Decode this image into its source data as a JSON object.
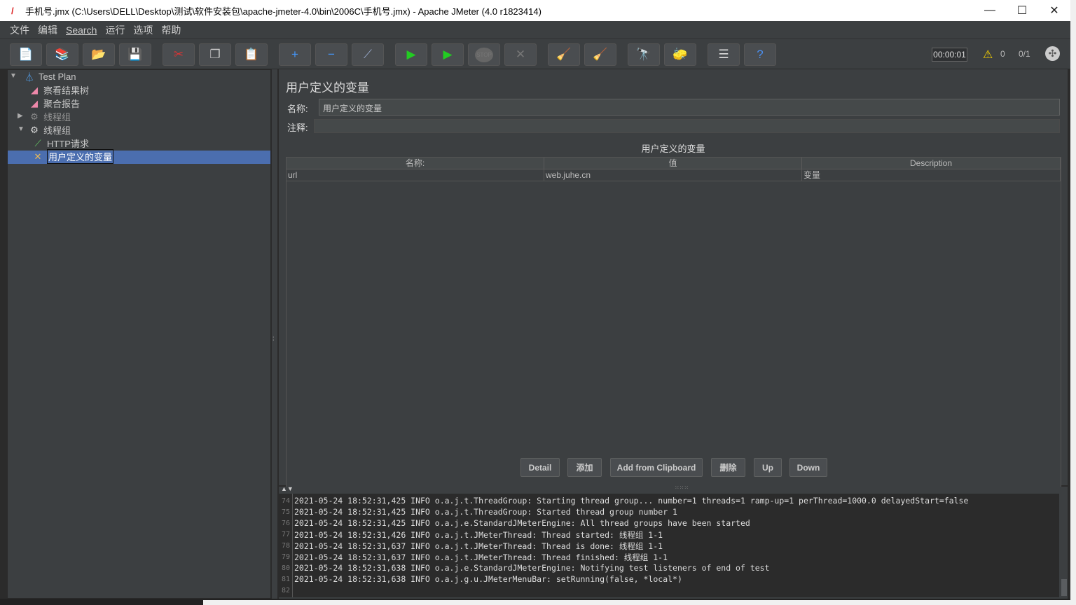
{
  "window": {
    "title": "手机号.jmx (C:\\Users\\DELL\\Desktop\\测试\\软件安装包\\apache-jmeter-4.0\\bin\\2006C\\手机号.jmx) - Apache JMeter (4.0 r1823414)",
    "minimize": "—",
    "maximize": "☐",
    "close": "✕"
  },
  "menu": [
    "文件",
    "编辑",
    "Search",
    "运行",
    "选项",
    "帮助"
  ],
  "toolbar": {
    "buttons": [
      {
        "name": "new",
        "icon": "📄"
      },
      {
        "name": "templates",
        "icon": "📚"
      },
      {
        "name": "open",
        "icon": "📂"
      },
      {
        "name": "save",
        "icon": "💾"
      },
      {
        "name": "cut",
        "icon": "✂"
      },
      {
        "name": "copy",
        "icon": "❐"
      },
      {
        "name": "paste",
        "icon": "📋"
      },
      {
        "name": "expand",
        "icon": "+"
      },
      {
        "name": "collapse",
        "icon": "−"
      },
      {
        "name": "toggle",
        "icon": "⟋"
      },
      {
        "name": "start",
        "icon": "▶"
      },
      {
        "name": "start-no-pause",
        "icon": "▶"
      },
      {
        "name": "stop",
        "icon": "STOP"
      },
      {
        "name": "shutdown",
        "icon": "✕"
      },
      {
        "name": "clear",
        "icon": "🧹"
      },
      {
        "name": "clear-all",
        "icon": "🧹"
      },
      {
        "name": "search",
        "icon": "🔭"
      },
      {
        "name": "reset-search",
        "icon": "🧽"
      },
      {
        "name": "function-helper",
        "icon": "☰"
      },
      {
        "name": "help",
        "icon": "?"
      }
    ],
    "timer": "00:00:01",
    "warnings": "0",
    "threads": "0/1"
  },
  "tree": [
    {
      "label": "Test Plan",
      "icon": "flask",
      "level": 0
    },
    {
      "label": "察看结果树",
      "icon": "graph",
      "level": 1
    },
    {
      "label": "聚合报告",
      "icon": "graph",
      "level": 1
    },
    {
      "label": "线程组",
      "icon": "gear-disabled",
      "level": 1
    },
    {
      "label": "线程组",
      "icon": "gear",
      "level": 1
    },
    {
      "label": "HTTP请求",
      "icon": "pipette",
      "level": 2
    },
    {
      "label": "用户定义的变量",
      "icon": "tools",
      "level": 2,
      "selected": true
    }
  ],
  "panel": {
    "title": "用户定义的变量",
    "name_label": "名称:",
    "name_value": "用户定义的变量",
    "comment_label": "注释:",
    "comment_value": "",
    "table_caption": "用户定义的变量",
    "columns": [
      "名称:",
      "值",
      "Description"
    ],
    "rows": [
      [
        "url",
        "web.juhe.cn",
        "变量"
      ]
    ],
    "buttons": [
      "Detail",
      "添加",
      "Add from Clipboard",
      "删除",
      "Up",
      "Down"
    ]
  },
  "log": {
    "lines": [
      {
        "n": "74",
        "t": "2021-05-24 18:52:31,425 INFO o.a.j.t.ThreadGroup: Starting thread group... number=1 threads=1 ramp-up=1 perThread=1000.0 delayedStart=false"
      },
      {
        "n": "75",
        "t": "2021-05-24 18:52:31,425 INFO o.a.j.t.ThreadGroup: Started thread group number 1"
      },
      {
        "n": "76",
        "t": "2021-05-24 18:52:31,425 INFO o.a.j.e.StandardJMeterEngine: All thread groups have been started"
      },
      {
        "n": "77",
        "t": "2021-05-24 18:52:31,426 INFO o.a.j.t.JMeterThread: Thread started: 线程组 1-1"
      },
      {
        "n": "78",
        "t": "2021-05-24 18:52:31,637 INFO o.a.j.t.JMeterThread: Thread is done: 线程组 1-1"
      },
      {
        "n": "79",
        "t": "2021-05-24 18:52:31,637 INFO o.a.j.t.JMeterThread: Thread finished: 线程组 1-1"
      },
      {
        "n": "80",
        "t": "2021-05-24 18:52:31,638 INFO o.a.j.e.StandardJMeterEngine: Notifying test listeners of end of test"
      },
      {
        "n": "81",
        "t": "2021-05-24 18:52:31,638 INFO o.a.j.g.u.JMeterMenuBar: setRunning(false, *local*)"
      },
      {
        "n": "82",
        "t": ""
      }
    ]
  }
}
